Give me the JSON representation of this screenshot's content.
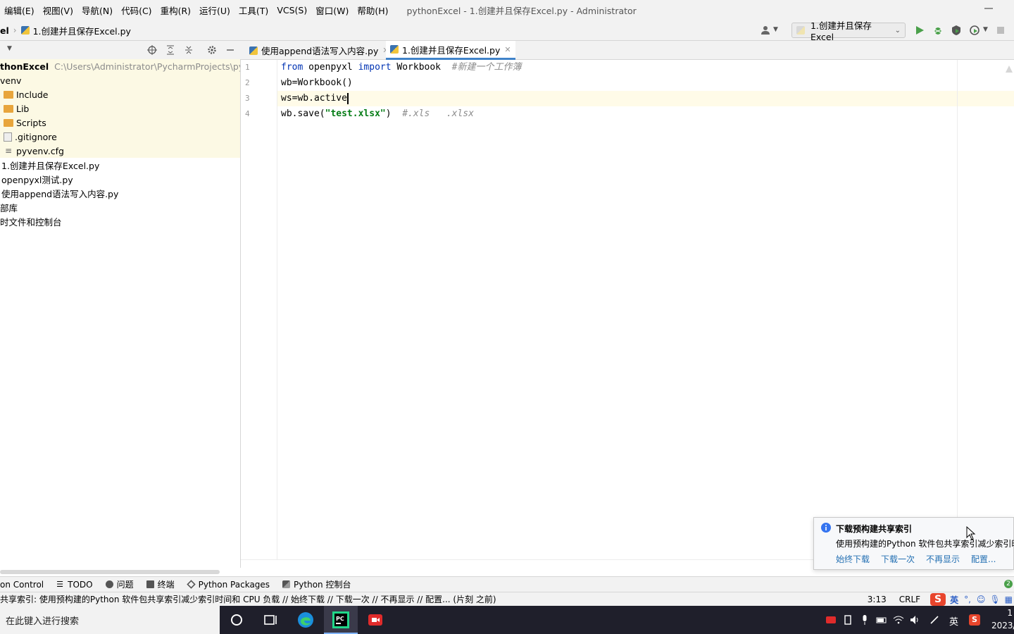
{
  "menu": {
    "items": [
      "编辑(E)",
      "视图(V)",
      "导航(N)",
      "代码(C)",
      "重构(R)",
      "运行(U)",
      "工具(T)",
      "VCS(S)",
      "窗口(W)",
      "帮助(H)"
    ],
    "title": "pythonExcel - 1.创建并且保存Excel.py - Administrator"
  },
  "nav": {
    "project_crumb": "el",
    "file_crumb": "1.创建并且保存Excel.py",
    "run_config": "1.创建并且保存Excel"
  },
  "project": {
    "root_name": "thonExcel",
    "root_path": "C:\\Users\\Administrator\\PycharmProjects\\python",
    "venv": "venv",
    "include": "Include",
    "lib": "Lib",
    "scripts": "Scripts",
    "gitignore": ".gitignore",
    "pyvenv": "pyvenv.cfg",
    "file1": "1.创建并且保存Excel.py",
    "file2": "openpyxl测试.py",
    "file3": "使用append语法写入内容.py",
    "ext_libs": "部库",
    "scratches": "时文件和控制台"
  },
  "tabs": [
    "使用append语法写入内容.py",
    "1.创建并且保存Excel.py"
  ],
  "editor": {
    "line_numbers": [
      "1",
      "2",
      "3",
      "4"
    ],
    "l1_from": "from",
    "l1_mod": " openpyxl ",
    "l1_import": "import",
    "l1_name": " Workbook  ",
    "l1_comment": "#新建一个工作簿",
    "l2": "wb=Workbook()",
    "l3": "ws=wb.active",
    "l4_a": "wb.save(",
    "l4_str": "\"test.xlsx\"",
    "l4_b": ")  ",
    "l4_comment": "#.xls   .xlsx"
  },
  "toolwindows": [
    "on Control",
    "TODO",
    "问题",
    "终端",
    "Python Packages",
    "Python 控制台"
  ],
  "status": {
    "message": "共享索引: 使用预构建的Python 软件包共享索引减少索引时间和 CPU 负载 // 始终下载 // 下载一次 // 不再显示 // 配置... (片刻 之前)",
    "position": "3:13",
    "line_sep": "CRLF",
    "ime_lang": "英"
  },
  "notification": {
    "title": "下载预构建共享索引",
    "body": "使用预构建的Python 软件包共享索引减少索引时间",
    "actions": [
      "始终下载",
      "下载一次",
      "不再显示",
      "配置..."
    ],
    "badge": "2"
  },
  "taskbar": {
    "search_placeholder": "在此键入进行搜索",
    "ime": "英",
    "time": "1",
    "date": "2023/"
  },
  "colors": {
    "accent": "#4083c9",
    "keyword": "#0033b3",
    "string": "#067d17",
    "comment": "#8c8c8c",
    "folder": "#e8a53c",
    "run": "#4aa04a"
  }
}
